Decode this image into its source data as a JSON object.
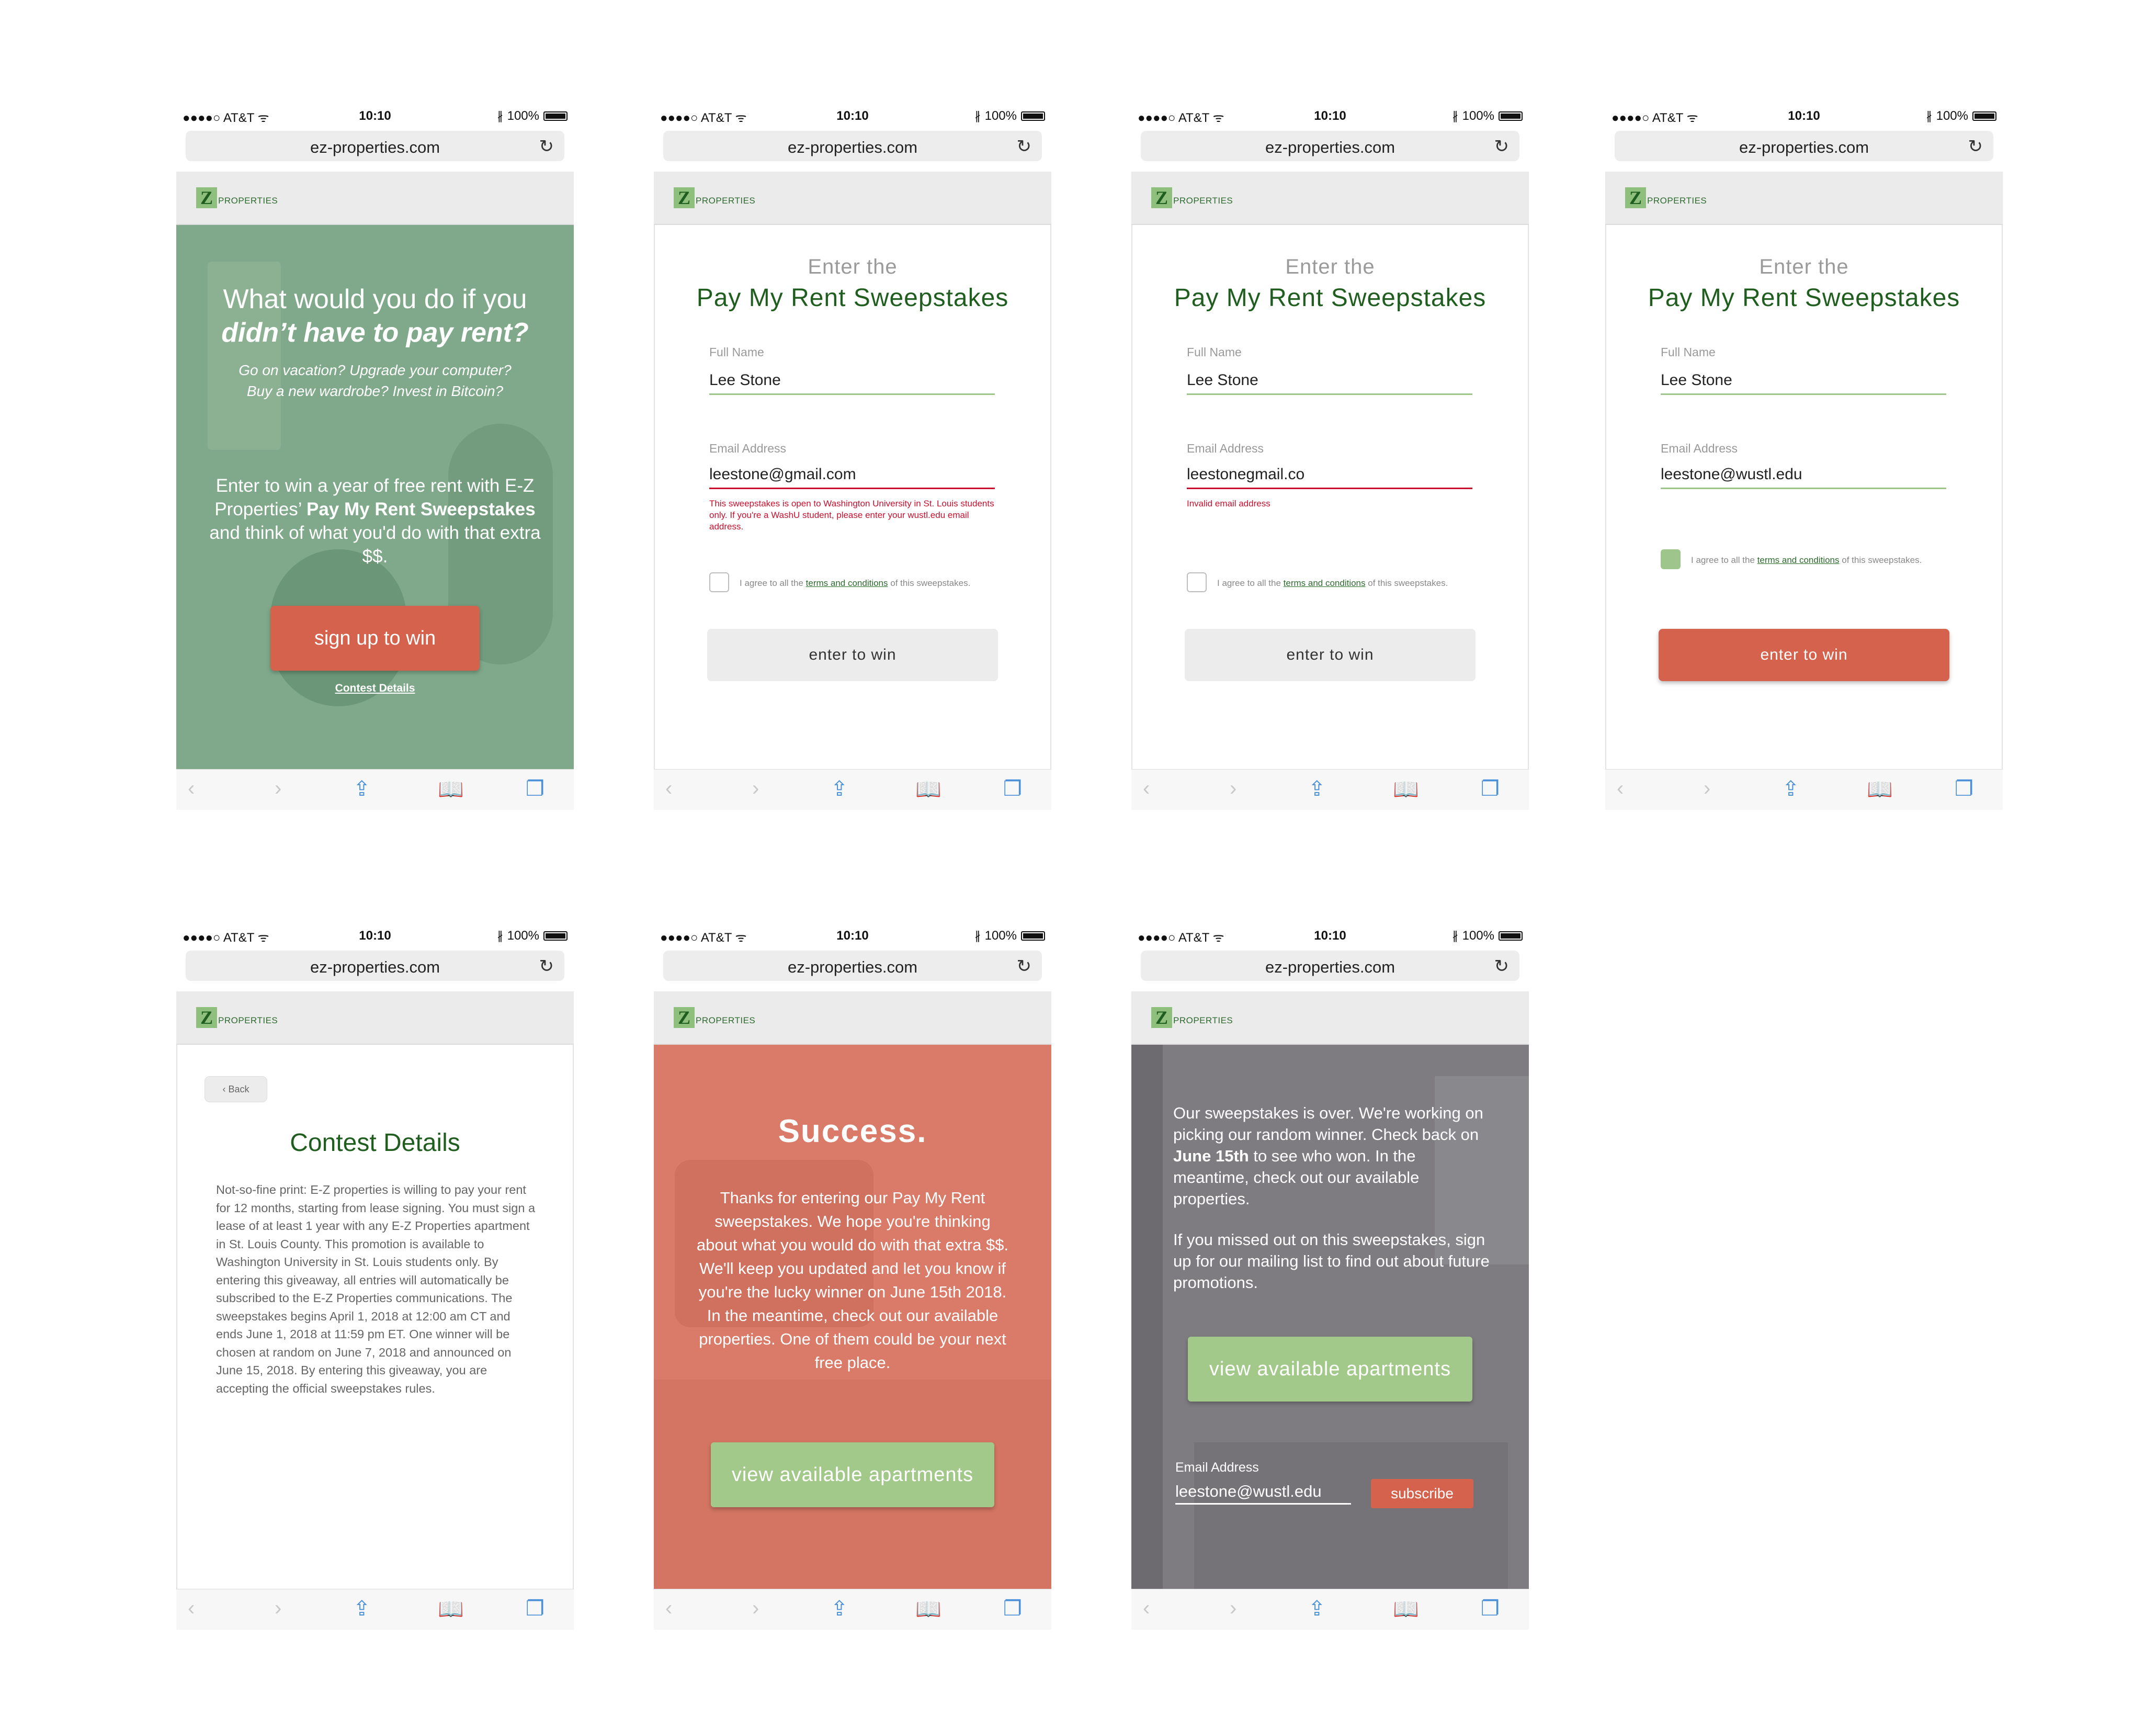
{
  "browser": {
    "carrier": "●●●●○ AT&T ᯤ",
    "time": "10:10",
    "battery": "100%",
    "url": "ez-properties.com"
  },
  "logo": {
    "mark": "Z",
    "word": "PROPERTIES"
  },
  "landing": {
    "headline_1": "What would you do if you",
    "headline_2": "didn’t have to pay rent?",
    "sub_1": "Go on vacation? Upgrade your computer?",
    "sub_2": "Buy a new wardrobe? Invest in Bitcoin?",
    "body_a": "Enter to win a year of free rent with E-Z Properties’ ",
    "body_b": "Pay My Rent Sweepstakes",
    "body_c": " and think of what you'd do with that extra $$.",
    "cta": "sign up to win",
    "details_link": "Contest Details"
  },
  "form": {
    "pre": "Enter the",
    "title": "Pay My Rent Sweepstakes",
    "name_label": "Full Name",
    "name_value": "Lee Stone",
    "email_label": "Email Address",
    "agree_a": "I agree to all the ",
    "agree_link": "terms and conditions",
    "agree_b": " of this sweepstakes.",
    "submit": "enter to win",
    "variants": {
      "v1": {
        "email": "leestone@gmail.com",
        "error": "This sweepstakes is open to Washington University in St. Louis students only. If you're a WashU student, please enter your wustl.edu email address."
      },
      "v2": {
        "email": "leestonegmail.co",
        "error": "Invalid email address"
      },
      "v3": {
        "email": "leestone@wustl.edu"
      }
    }
  },
  "details": {
    "back": "Back",
    "title": "Contest Details",
    "text": "Not-so-fine print: E-Z properties is willing to pay your rent for 12 months, starting from lease signing. You must sign a lease of at least 1 year with any E-Z Properties apartment in St. Louis County. This promotion is available to Washington University in St. Louis students only. By entering this giveaway, all entries will automatically be subscribed to the E-Z Properties communications. The sweepstakes begins April 1, 2018 at 12:00 am CT and ends June 1, 2018 at 11:59 pm ET. One winner will be chosen at random on June 7, 2018 and announced on June 15, 2018. By entering this giveaway, you are accepting the official sweepstakes rules."
  },
  "success": {
    "title": "Success.",
    "text": "Thanks for entering our Pay My Rent sweepstakes. We hope you're thinking about what you would do with that extra $$. We'll keep you updated and let you know if you're the lucky winner on June 15th 2018. In the meantime, check out our available properties. One of them could be your next free place.",
    "button": "view available apartments"
  },
  "over": {
    "p1_a": "Our sweepstakes is over. We're working on picking our random winner. Check back on ",
    "p1_b": "June 15th",
    "p1_c": " to see who won. In the meantime, check out our available properties.",
    "p2": "If you missed out on this sweepstakes, sign up for our mailing list to find out about future promotions.",
    "button": "view available apartments",
    "email_label": "Email Address",
    "email_value": "leestone@wustl.edu",
    "subscribe": "subscribe"
  },
  "icons": {
    "back": "‹",
    "forward": "›",
    "share": "⇪",
    "bookmarks": "📖",
    "tabs": "❐",
    "reload": "↻",
    "bluetooth": "∦"
  },
  "colors": {
    "brand_green": "#1f5e1f",
    "accent_red": "#d4624c",
    "light_green": "#a2c98a",
    "error_red": "#c8102e"
  }
}
